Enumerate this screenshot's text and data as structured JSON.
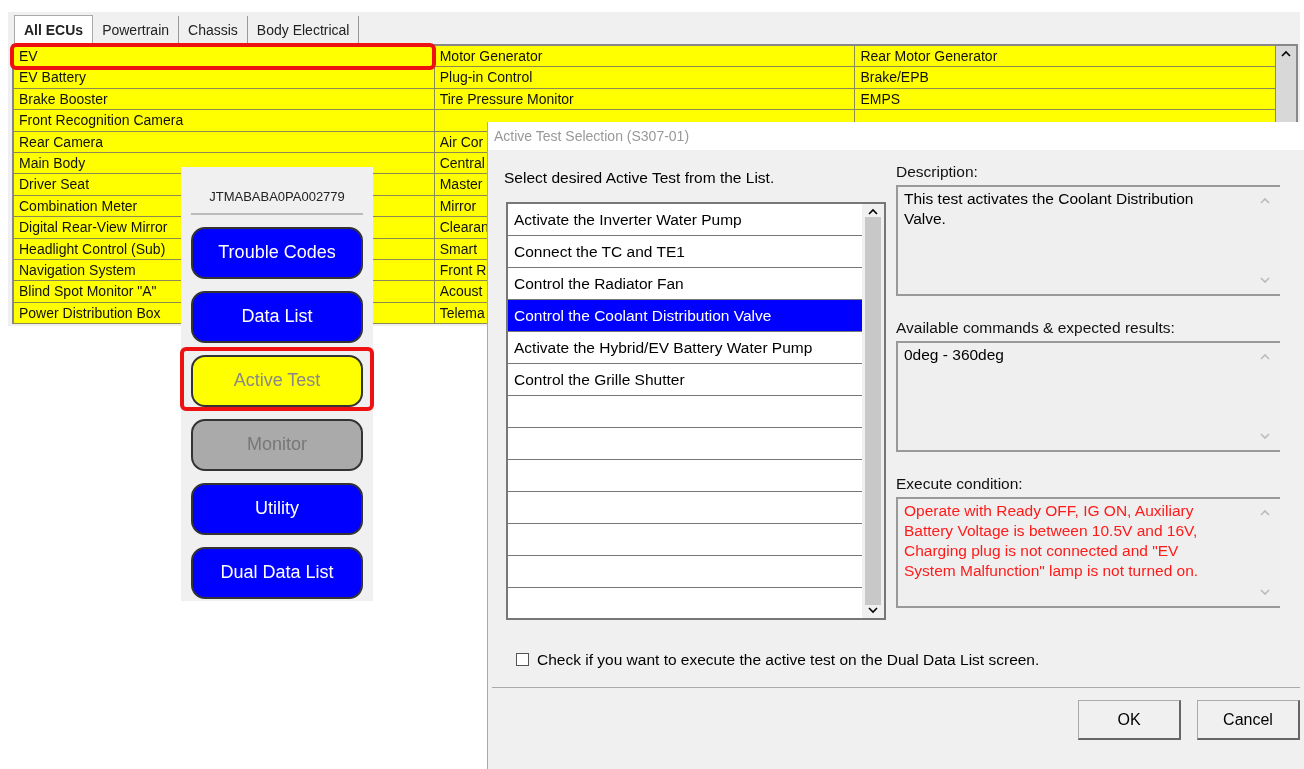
{
  "ecu_window": {
    "tabs": [
      {
        "label": "All ECUs",
        "selected": true
      },
      {
        "label": "Powertrain",
        "selected": false
      },
      {
        "label": "Chassis",
        "selected": false
      },
      {
        "label": "Body Electrical",
        "selected": false
      }
    ],
    "columns": [
      [
        {
          "label": "EV",
          "highlighted": true
        },
        {
          "label": "EV Battery",
          "highlighted": false
        },
        {
          "label": "Brake Booster",
          "highlighted": false
        },
        {
          "label": "Front Recognition Camera",
          "highlighted": false
        },
        {
          "label": "Rear Camera",
          "highlighted": false
        },
        {
          "label": "Main Body",
          "highlighted": false
        },
        {
          "label": "Driver Seat",
          "highlighted": false
        },
        {
          "label": "Combination Meter",
          "highlighted": false
        },
        {
          "label": "Digital Rear-View Mirror",
          "highlighted": false
        },
        {
          "label": "Headlight Control (Sub)",
          "highlighted": false
        },
        {
          "label": "Navigation System",
          "highlighted": false
        },
        {
          "label": "Blind Spot Monitor \"A\"",
          "highlighted": false
        },
        {
          "label": "Power Distribution Box",
          "highlighted": false
        }
      ],
      [
        {
          "label": "Motor Generator",
          "highlighted": false
        },
        {
          "label": "Plug-in Control",
          "highlighted": false
        },
        {
          "label": "Tire Pressure Monitor",
          "highlighted": false
        },
        null,
        {
          "label": "Air Cor",
          "highlighted": false
        },
        {
          "label": "Central",
          "highlighted": false
        },
        {
          "label": "Master",
          "highlighted": false
        },
        {
          "label": "Mirror",
          "highlighted": false
        },
        {
          "label": "Clearan",
          "highlighted": false
        },
        {
          "label": "Smart",
          "highlighted": false
        },
        {
          "label": "Front R",
          "highlighted": false
        },
        {
          "label": "Acoust",
          "highlighted": false
        },
        {
          "label": "Telema",
          "highlighted": false
        }
      ],
      [
        {
          "label": "Rear Motor Generator",
          "highlighted": false
        },
        {
          "label": "Brake/EPB",
          "highlighted": false
        },
        {
          "label": "EMPS",
          "highlighted": false
        },
        null
      ]
    ]
  },
  "function_panel": {
    "vin": "JTMABABA0PA002779",
    "buttons": [
      {
        "label": "Trouble Codes",
        "selected": false,
        "disabled": false,
        "highlighted": false
      },
      {
        "label": "Data List",
        "selected": false,
        "disabled": false,
        "highlighted": false
      },
      {
        "label": "Active Test",
        "selected": true,
        "disabled": false,
        "highlighted": true
      },
      {
        "label": "Monitor",
        "selected": false,
        "disabled": true,
        "highlighted": false
      },
      {
        "label": "Utility",
        "selected": false,
        "disabled": false,
        "highlighted": false
      },
      {
        "label": "Dual Data List",
        "selected": false,
        "disabled": false,
        "highlighted": false
      }
    ]
  },
  "dialog": {
    "title": "Active Test Selection (S307-01)",
    "instruction": "Select desired Active Test from the List.",
    "tests": [
      {
        "label": "Activate the Inverter Water Pump",
        "selected": false
      },
      {
        "label": "Connect the TC and TE1",
        "selected": false
      },
      {
        "label": "Control the Radiator Fan",
        "selected": false
      },
      {
        "label": "Control the Coolant Distribution Valve",
        "selected": true
      },
      {
        "label": "Activate the Hybrid/EV Battery Water Pump",
        "selected": false
      },
      {
        "label": "Control the Grille Shutter",
        "selected": false
      }
    ],
    "description": {
      "label": "Description:",
      "text": "This test activates the Coolant Distribution Valve."
    },
    "commands": {
      "label": "Available commands & expected results:",
      "text": "0deg - 360deg"
    },
    "condition": {
      "label": "Execute condition:",
      "text": "Operate with Ready OFF, IG ON, Auxiliary Battery Voltage is between 10.5V and 16V, Charging plug is not connected and \"EV System Malfunction\" lamp is not turned on."
    },
    "dual_option": {
      "label": "Check if you want to execute the active test on the Dual Data List screen.",
      "checked": false
    },
    "buttons": [
      "OK",
      "Cancel"
    ]
  }
}
